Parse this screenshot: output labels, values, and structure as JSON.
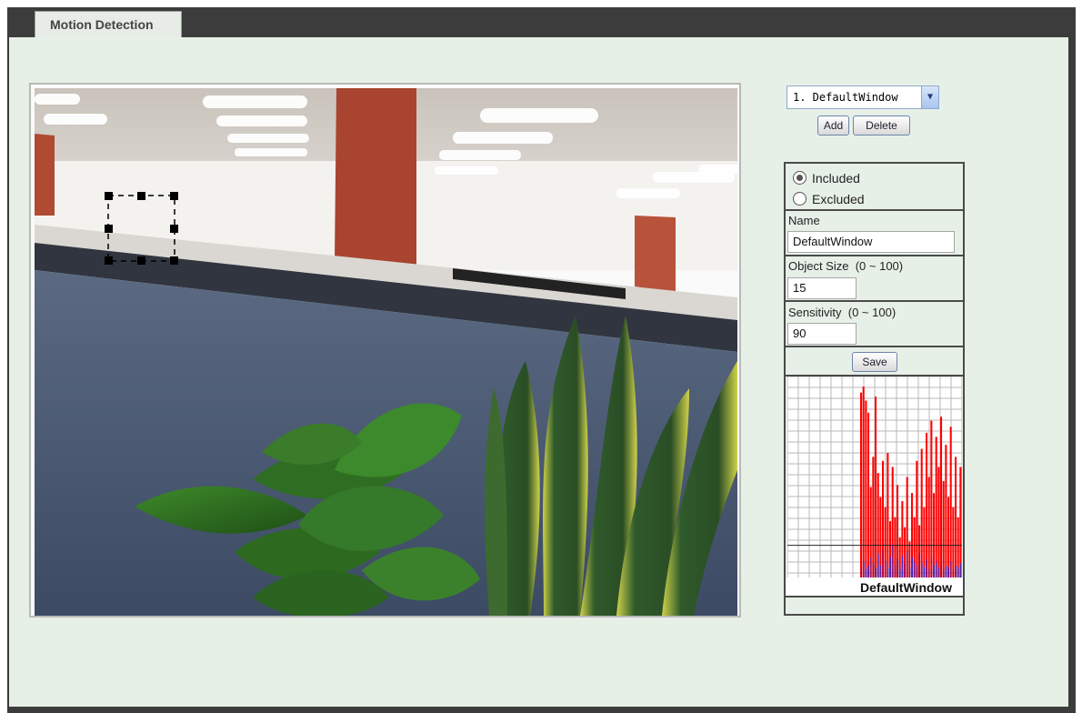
{
  "tab": {
    "label": "Motion Detection"
  },
  "window_select": {
    "value": "1. DefaultWindow"
  },
  "buttons": {
    "add": "Add",
    "delete": "Delete",
    "save": "Save"
  },
  "mode": {
    "included": "Included",
    "excluded": "Excluded",
    "selected": "included"
  },
  "form": {
    "name_label": "Name",
    "name_value": "DefaultWindow",
    "object_size_label": "Object Size",
    "object_size_range": "(0 ~ 100)",
    "object_size_value": "15",
    "sensitivity_label": "Sensitivity",
    "sensitivity_range": "(0 ~ 100)",
    "sensitivity_value": "90"
  },
  "graph": {
    "title": "DefaultWindow",
    "colors": {
      "motion": "#ff0000",
      "threshold": "#2b2bd6",
      "grid": "#b8b8b8"
    },
    "threshold_level": 0.16,
    "bars_red": [
      0.92,
      0.95,
      0.88,
      0.82,
      0.45,
      0.6,
      0.9,
      0.52,
      0.4,
      0.58,
      0.35,
      0.62,
      0.28,
      0.55,
      0.3,
      0.46,
      0.2,
      0.38,
      0.25,
      0.5,
      0.18,
      0.42,
      0.3,
      0.58,
      0.26,
      0.64,
      0.35,
      0.72,
      0.5,
      0.78,
      0.42,
      0.7,
      0.55,
      0.8,
      0.48,
      0.66,
      0.4,
      0.75,
      0.35,
      0.6,
      0.3,
      0.55
    ],
    "bars_blue": [
      0.05,
      0.08,
      0.04,
      0.06,
      0.1,
      0.07,
      0.05,
      0.12,
      0.06,
      0.14,
      0.08,
      0.05,
      0.1,
      0.16,
      0.06,
      0.09,
      0.04,
      0.11,
      0.07,
      0.13,
      0.05,
      0.1,
      0.08,
      0.06,
      0.12,
      0.07,
      0.05,
      0.09,
      0.04,
      0.1,
      0.06,
      0.08,
      0.05,
      0.07,
      0.04,
      0.06,
      0.05,
      0.08,
      0.04,
      0.06,
      0.05,
      0.07
    ]
  }
}
